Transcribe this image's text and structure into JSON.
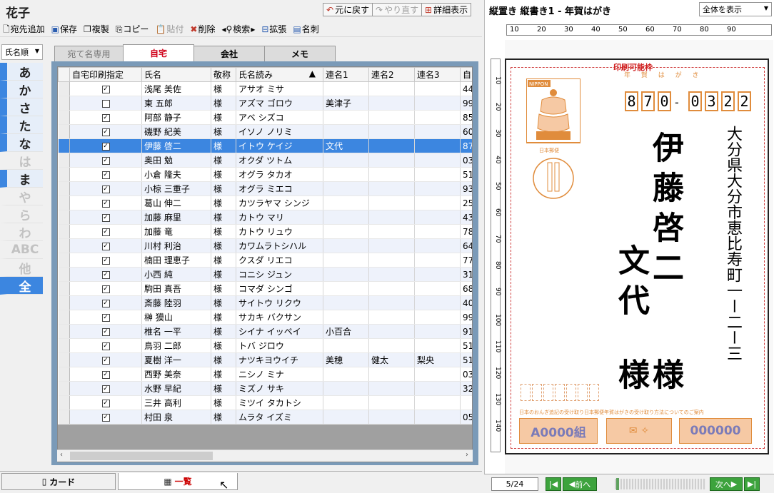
{
  "window": {
    "title": "花子"
  },
  "history": {
    "undo": "元に戻す",
    "redo": "やり直す",
    "detail": "詳細表示"
  },
  "toolbar": {
    "add_addressee": "宛先追加",
    "save": "保存",
    "duplicate": "複製",
    "copy": "コピー",
    "paste": "貼付",
    "delete": "削除",
    "search": "検索",
    "expand": "拡張",
    "card_name": "名刺"
  },
  "index": {
    "sort": "氏名順",
    "kana": [
      {
        "label": "あ",
        "state": "hasdata"
      },
      {
        "label": "か",
        "state": "hasdata"
      },
      {
        "label": "さ",
        "state": "hasdata"
      },
      {
        "label": "た",
        "state": "hasdata"
      },
      {
        "label": "な",
        "state": "hasdata"
      },
      {
        "label": "は",
        "state": "empty"
      },
      {
        "label": "ま",
        "state": "hasdata"
      },
      {
        "label": "や",
        "state": "empty"
      },
      {
        "label": "ら",
        "state": "empty"
      },
      {
        "label": "わ",
        "state": "empty"
      },
      {
        "label": "ABC",
        "state": "empty"
      },
      {
        "label": "他",
        "state": "empty"
      },
      {
        "label": "全",
        "state": "sel"
      }
    ]
  },
  "tabs": [
    {
      "label": "宛て名専用",
      "state": "first"
    },
    {
      "label": "自宅",
      "state": "act"
    },
    {
      "label": "会社",
      "state": ""
    },
    {
      "label": "メモ",
      "state": ""
    }
  ],
  "grid": {
    "columns": [
      "自宅印刷指定",
      "氏名",
      "敬称",
      "氏名読み",
      "連名1",
      "連名2",
      "連名3",
      "自"
    ],
    "sort_marker": "▲",
    "rows": [
      {
        "checked": true,
        "name": "浅尾 美佐",
        "honor": "様",
        "reading": "アサオ ミサ",
        "r1": "",
        "r2": "",
        "r3": "",
        "home": "44"
      },
      {
        "checked": false,
        "name": "東 五郎",
        "honor": "様",
        "reading": "アズマ ゴロウ",
        "r1": "美津子",
        "r2": "",
        "r3": "",
        "home": "99"
      },
      {
        "checked": true,
        "name": "阿部 静子",
        "honor": "様",
        "reading": "アベ シズコ",
        "r1": "",
        "r2": "",
        "r3": "",
        "home": "85"
      },
      {
        "checked": true,
        "name": "磯野 紀美",
        "honor": "様",
        "reading": "イソノ ノリミ",
        "r1": "",
        "r2": "",
        "r3": "",
        "home": "60"
      },
      {
        "checked": true,
        "name": "伊藤 啓二",
        "honor": "様",
        "reading": "イトウ ケイジ",
        "r1": "文代",
        "r2": "",
        "r3": "",
        "home": "87",
        "selected": true
      },
      {
        "checked": true,
        "name": "奥田 勉",
        "honor": "様",
        "reading": "オクダ ツトム",
        "r1": "",
        "r2": "",
        "r3": "",
        "home": "03"
      },
      {
        "checked": true,
        "name": "小倉 隆夫",
        "honor": "様",
        "reading": "オグラ タカオ",
        "r1": "",
        "r2": "",
        "r3": "",
        "home": "51"
      },
      {
        "checked": true,
        "name": "小椋 三重子",
        "honor": "様",
        "reading": "オグラ ミエコ",
        "r1": "",
        "r2": "",
        "r3": "",
        "home": "93"
      },
      {
        "checked": true,
        "name": "葛山 伸二",
        "honor": "様",
        "reading": "カツラヤマ シンジ",
        "r1": "",
        "r2": "",
        "r3": "",
        "home": "25"
      },
      {
        "checked": true,
        "name": "加藤 麻里",
        "honor": "様",
        "reading": "カトウ マリ",
        "r1": "",
        "r2": "",
        "r3": "",
        "home": "43"
      },
      {
        "checked": true,
        "name": "加藤 竜",
        "honor": "様",
        "reading": "カトウ リュウ",
        "r1": "",
        "r2": "",
        "r3": "",
        "home": "78"
      },
      {
        "checked": true,
        "name": "川村 利治",
        "honor": "様",
        "reading": "カワムラトシハル",
        "r1": "",
        "r2": "",
        "r3": "",
        "home": "64"
      },
      {
        "checked": true,
        "name": "楠田 理恵子",
        "honor": "様",
        "reading": "クスダ リエコ",
        "r1": "",
        "r2": "",
        "r3": "",
        "home": "77"
      },
      {
        "checked": true,
        "name": "小西 純",
        "honor": "様",
        "reading": "コニシ ジュン",
        "r1": "",
        "r2": "",
        "r3": "",
        "home": "31"
      },
      {
        "checked": true,
        "name": "駒田 真吾",
        "honor": "様",
        "reading": "コマダ シンゴ",
        "r1": "",
        "r2": "",
        "r3": "",
        "home": "68"
      },
      {
        "checked": true,
        "name": "斎藤 陸羽",
        "honor": "様",
        "reading": "サイトウ リクウ",
        "r1": "",
        "r2": "",
        "r3": "",
        "home": "40"
      },
      {
        "checked": true,
        "name": "榊 獏山",
        "honor": "様",
        "reading": "サカキ バクサン",
        "r1": "",
        "r2": "",
        "r3": "",
        "home": "99"
      },
      {
        "checked": true,
        "name": "椎名 一平",
        "honor": "様",
        "reading": "シイナ イッペイ",
        "r1": "小百合",
        "r2": "",
        "r3": "",
        "home": "91"
      },
      {
        "checked": true,
        "name": "鳥羽 二郎",
        "honor": "様",
        "reading": "トバ ジロウ",
        "r1": "",
        "r2": "",
        "r3": "",
        "home": "51"
      },
      {
        "checked": true,
        "name": "夏樹 洋一",
        "honor": "様",
        "reading": "ナツキヨウイチ",
        "r1": "美穂",
        "r2": "健太",
        "r3": "梨央",
        "home": "51"
      },
      {
        "checked": true,
        "name": "西野 美奈",
        "honor": "様",
        "reading": "ニシノ ミナ",
        "r1": "",
        "r2": "",
        "r3": "",
        "home": "03"
      },
      {
        "checked": true,
        "name": "水野 早紀",
        "honor": "様",
        "reading": "ミズノ サキ",
        "r1": "",
        "r2": "",
        "r3": "",
        "home": "32"
      },
      {
        "checked": true,
        "name": "三井 高利",
        "honor": "様",
        "reading": "ミツイ タカトシ",
        "r1": "",
        "r2": "",
        "r3": "",
        "home": ""
      },
      {
        "checked": true,
        "name": "村田 泉",
        "honor": "様",
        "reading": "ムラタ イズミ",
        "r1": "",
        "r2": "",
        "r3": "",
        "home": "05"
      }
    ]
  },
  "bottom_tabs": {
    "card": "カード",
    "list": "一覧"
  },
  "preview": {
    "title": "縦置き 縦書き1 - 年賀はがき",
    "zoom": "全体を表示",
    "ruler_h": [
      "10",
      "20",
      "30",
      "40",
      "50",
      "60",
      "70",
      "80",
      "90"
    ],
    "ruler_v": [
      "10",
      "20",
      "30",
      "40",
      "50",
      "60",
      "70",
      "80",
      "90",
      "100",
      "110",
      "120",
      "130",
      "140"
    ],
    "print_area_label": "印刷可能枠",
    "card_kind": "年 賀 は が き",
    "stamp": {
      "brand": "NIPPON",
      "postage": "日本郵便"
    },
    "zip": [
      "8",
      "7",
      "0",
      "0",
      "3",
      "2",
      "2"
    ],
    "zip_separator": "-",
    "address": "大分県大分市恵比寿町一ー二ー三",
    "name_main": "伊藤啓二",
    "honor_main": "様",
    "name_joint": "文代",
    "honor_joint": "様",
    "sender_note": "日本のおんぎ追記の受け取り日本郵便年賀はがきの受け取り方法についてのご案内",
    "lot_group": "A0000組",
    "lot_number": "000000",
    "page": "5/24",
    "prev": "前へ",
    "next": "次へ"
  },
  "colors": {
    "accent": "#3c86e0",
    "tab_active": "#d0021b",
    "stamp_orange": "#e08c3c",
    "nav_green": "#3da33d"
  }
}
